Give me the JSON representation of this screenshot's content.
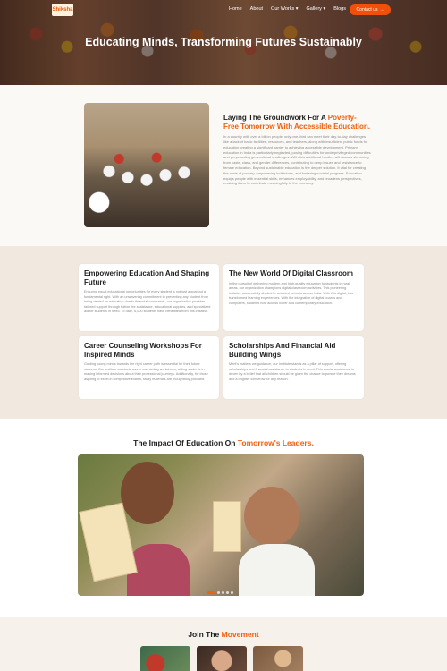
{
  "nav": {
    "logo_text": "Shiksha",
    "links": [
      "Home",
      "About",
      "Our Works ▾",
      "Gallery ▾",
      "Blogs"
    ],
    "contact_label": "Contact us",
    "contact_arrow": "→"
  },
  "hero": {
    "title": "Educating Minds, Transforming Futures Sustainably"
  },
  "intro": {
    "heading_line1": "Laying The Groundwork For A",
    "heading_accent": "Poverty-Free Tomorrow With Accessible Education.",
    "paragraph": "In a country with over a billion people, only one-third can meet their day-to-day challenges like a lack of basic facilities, resources, and teachers, along with insufficient public funds for education creating a significant barrier to achieving accessible development. Primary education in India is particularly neglected, posing difficulties for underprivileged communities and perpetuating generational challenges. With this additional hurdles with issues stemming from caste, class, and gender differences, contributing to deep issues and resistance to female education. Beyond sustainable education is the deeper solution. It vital for creating the cycle of poverty, empowering individuals, and fostering societal progress. Education equips people with essential skills, enhances employability, and broadens perspectives, enabling them to contribute meaningfully to the economy."
  },
  "cards": [
    {
      "title": "Empowering Education And Shaping Future",
      "text": "Ensuring equal educational opportunities for every student is not just a goal but a fundamental right. With an unwavering commitment to preventing any student from being denied an education due to financial constraints, our organization provides tailored support through tuition fee assistance, educational supplies, and specialized aid for students in need. To date, 6,000 students have benefitted from this initiative."
    },
    {
      "title": "The New World Of Digital Classroom",
      "text": "In the pursuit of delivering modern and high-quality education to students in rural areas, our organization champions digital classroom activities. This pioneering initiative successfully divided to selected schools across India. With this digital, has transformed learning experiences. With the integration of digital boards and computers, students now access richer and contemporary education."
    },
    {
      "title": "Career Counseling Workshops For Inspired Minds",
      "text": "Guiding young minds towards the right career path is essential for their future success. Our institute conducts career counseling workshops, aiding students in making informed decisions about their professional journeys. Additionally, for those aspiring to excel in competitive exams, study materials are thoughtfully provided."
    },
    {
      "title": "Scholarships And Financial Aid Building Wings",
      "text": "Merit's matters we guidance, our Institute stands as a pillar of support, offering scholarships and financial assistance to students in need. This crucial assistance is driven by a belief that all children should be given the chance to pursue their dreams and a brighter tomorrow for any reason."
    }
  ],
  "impact": {
    "heading_prefix": "The Impact Of Education On",
    "heading_accent": "Tomorrow's Leaders."
  },
  "carousel": {
    "slide_count": 5,
    "active_index": 0
  },
  "movement": {
    "heading_prefix": "Join The",
    "heading_accent": "Movement"
  },
  "colors": {
    "accent": "#f0600f",
    "section_beige": "#f1e9df",
    "button": "#f0500a"
  }
}
